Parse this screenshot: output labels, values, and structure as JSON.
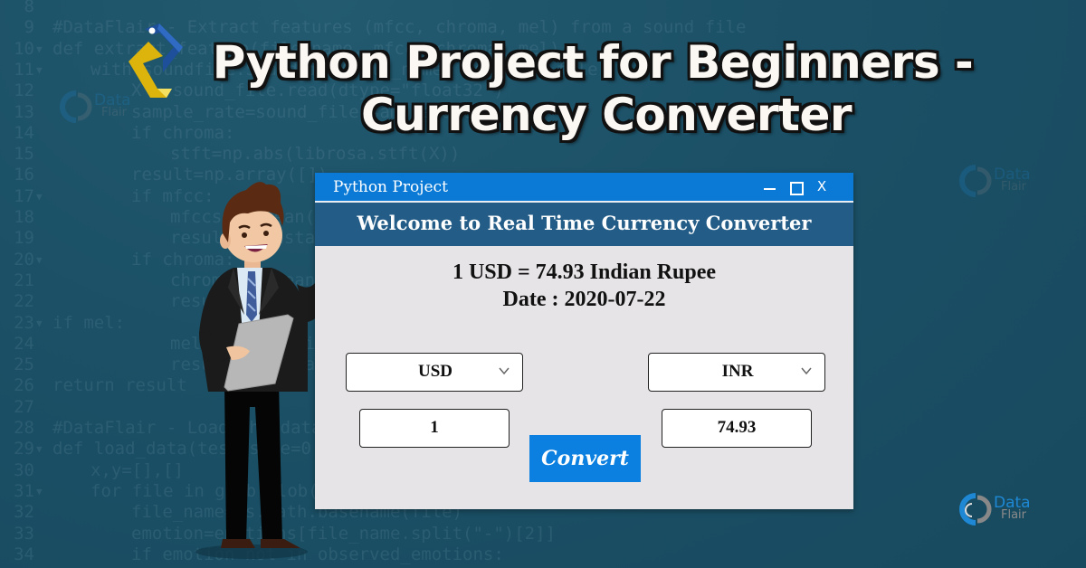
{
  "banner": {
    "title_line1": "Python Project for Beginners -",
    "title_line2": "Currency Converter"
  },
  "watermark": {
    "brand_top": "Data",
    "brand_bottom": "Flair"
  },
  "background_code": [
    {
      "num": "8",
      "fold": false,
      "text": ""
    },
    {
      "num": "9",
      "fold": false,
      "text": "#DataFlair - Extract features (mfcc, chroma, mel) from a sound file"
    },
    {
      "num": "10",
      "fold": true,
      "text": "def extract_feature(file_name, mfcc, chroma, mel):"
    },
    {
      "num": "11",
      "fold": true,
      "text": "    with soundfile.SoundFile(file_name) as sound_file:"
    },
    {
      "num": "12",
      "fold": false,
      "text": "        X = sound_file.read(dtype=\"float32\")"
    },
    {
      "num": "13",
      "fold": false,
      "text": "        sample_rate=sound_file.samplerate"
    },
    {
      "num": "14",
      "fold": false,
      "text": "        if chroma:"
    },
    {
      "num": "15",
      "fold": false,
      "text": "            stft=np.abs(librosa.stft(X))"
    },
    {
      "num": "16",
      "fold": false,
      "text": "        result=np.array([])"
    },
    {
      "num": "17",
      "fold": true,
      "text": "        if mfcc:"
    },
    {
      "num": "18",
      "fold": false,
      "text": "            mfccs=np.mean(librosa.feature.mfcc(y=X, sr=sample_rate).T, axis=0)"
    },
    {
      "num": "19",
      "fold": false,
      "text": "            result=np.hstack((result, mfccs))"
    },
    {
      "num": "20",
      "fold": true,
      "text": "        if chroma:"
    },
    {
      "num": "21",
      "fold": false,
      "text": "            chroma=np.mean(librosa.feature.chroma_stft(S=stft).T,axis=0)"
    },
    {
      "num": "22",
      "fold": false,
      "text": "            result=np.hstack((result, chroma))"
    },
    {
      "num": "23",
      "fold": true,
      "text": "if mel:"
    },
    {
      "num": "24",
      "fold": false,
      "text": "            mel=np.mean(librosa.feature.melspectrogram(X).T,axis=0)"
    },
    {
      "num": "25",
      "fold": false,
      "text": "            result=np.hstack((result, mel))"
    },
    {
      "num": "26",
      "fold": false,
      "text": "return result"
    },
    {
      "num": "27",
      "fold": false,
      "text": ""
    },
    {
      "num": "28",
      "fold": false,
      "text": "#DataFlair - Load the data"
    },
    {
      "num": "29",
      "fold": true,
      "text": "def load_data(test_size=0.2):"
    },
    {
      "num": "30",
      "fold": false,
      "text": "    x,y=[],[]"
    },
    {
      "num": "31",
      "fold": true,
      "text": "    for file in glob.glob(\"..\"):"
    },
    {
      "num": "32",
      "fold": false,
      "text": "        file_name=os.path.basename(file)"
    },
    {
      "num": "33",
      "fold": false,
      "text": "        emotion=emotions[file_name.split(\"-\")[2]]"
    },
    {
      "num": "34",
      "fold": false,
      "text": "        if emotion not in observed_emotions:"
    }
  ],
  "window": {
    "title": "Python Project",
    "controls": {
      "minimize": "minimize",
      "maximize": "maximize",
      "close": "X"
    },
    "header": "Welcome to Real Time Currency Converter",
    "rate_text": "1 USD = 74.93 Indian Rupee",
    "date_text": "Date : 2020-07-22",
    "from_currency": "USD",
    "to_currency": "INR",
    "amount": "1",
    "result": "74.93",
    "convert_label": "Convert"
  },
  "colors": {
    "background": "#1b5066",
    "titlebar": "#0a7ad6",
    "header_band": "#225c87",
    "window_body": "#e6e4e6",
    "convert_button": "#0b80e0"
  }
}
